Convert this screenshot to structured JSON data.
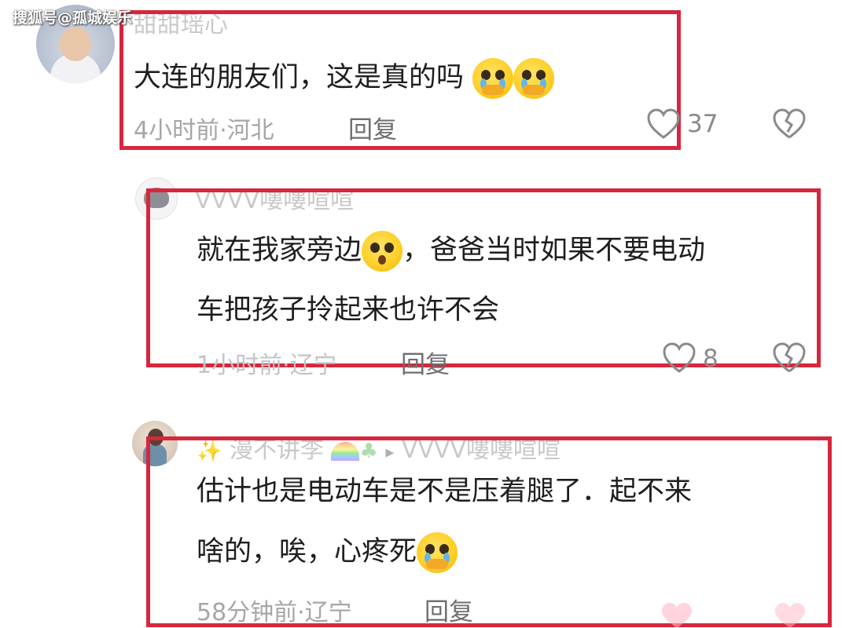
{
  "watermark": "搜狐号@孤城娱乐",
  "comments": [
    {
      "username": "甜甜瑶心",
      "text": "大连的朋友们，这是真的吗",
      "emojis": [
        "crying-hands-emoji",
        "crying-hands-emoji"
      ],
      "time": "4小时前",
      "location": "河北",
      "reply_label": "回复",
      "likes": "37"
    },
    {
      "username": "VVVV嘍嘍喧喧",
      "text_line1_a": "就在我家旁边",
      "text_line1_b": "，爸爸当时如果不要电动",
      "text_line2": "车把孩子拎起来也许不会",
      "time": "1小时前",
      "location": "辽宁",
      "reply_label": "回复",
      "likes": "8"
    },
    {
      "username": "漫不讲李",
      "reply_to": "VVVV嘍嘍喧喧",
      "text_line1": "估计也是电动车是不是压着腿了．起不来",
      "text_line2": "啥的，唉，心疼死",
      "time": "58分钟前",
      "location": "辽宁",
      "reply_label": "回复"
    }
  ],
  "meta_separator": "·",
  "colors": {
    "highlight_box": "#d7263d",
    "meta_text": "#a6a6a6"
  }
}
